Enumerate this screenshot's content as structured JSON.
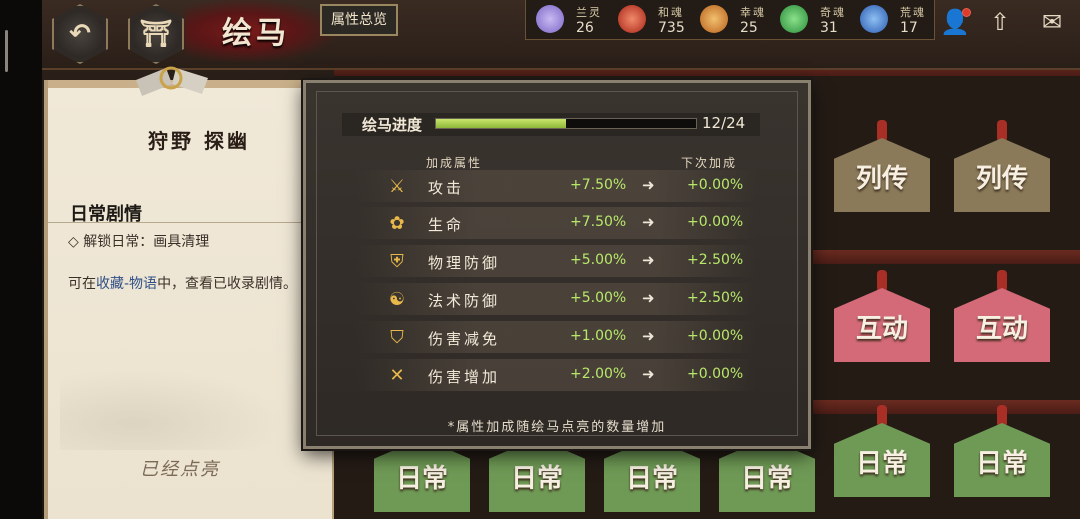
{
  "header": {
    "title": "绘马",
    "attr_button": "属性总览"
  },
  "currencies": [
    {
      "name": "兰灵",
      "value": "26",
      "color": "#8d7fd6",
      "icon": "spirit-icon"
    },
    {
      "name": "和魂",
      "value": "735",
      "color": "#c83a2a",
      "icon": "peace-soul-icon"
    },
    {
      "name": "幸魂",
      "value": "25",
      "color": "#d98a2a",
      "icon": "luck-soul-icon"
    },
    {
      "name": "奇魂",
      "value": "31",
      "color": "#3fa24a",
      "icon": "wonder-soul-icon"
    },
    {
      "name": "荒魂",
      "value": "17",
      "color": "#3c7fd0",
      "icon": "rough-soul-icon"
    }
  ],
  "left_panel": {
    "title": "狩野 探幽",
    "section_title": "日常剧情",
    "unlock": "◇ 解锁日常：画具清理",
    "desc_prefix": "可在",
    "desc_link": "收藏-物语",
    "desc_suffix": "中，查看已收录剧情。",
    "status": "已经点亮"
  },
  "ema_labels": [
    "列传",
    "列传",
    "互动",
    "互动",
    "日常",
    "日常",
    "日常",
    "日常",
    "日常",
    "日常"
  ],
  "modal": {
    "progress_label": "绘马进度",
    "progress_text": "12/24",
    "progress_value": 0.5,
    "col_attr": "加成属性",
    "col_next": "下次加成",
    "rows": [
      {
        "name": "攻击",
        "icon": "sword-icon",
        "current": "+7.50%",
        "next": "+0.00%"
      },
      {
        "name": "生命",
        "icon": "flower-icon",
        "current": "+7.50%",
        "next": "+0.00%"
      },
      {
        "name": "物理防御",
        "icon": "armor-icon",
        "current": "+5.00%",
        "next": "+2.50%"
      },
      {
        "name": "法术防御",
        "icon": "yin-yang-icon",
        "current": "+5.00%",
        "next": "+2.50%"
      },
      {
        "name": "伤害减免",
        "icon": "shield-icon",
        "current": "+1.00%",
        "next": "+0.00%"
      },
      {
        "name": "伤害增加",
        "icon": "crossed-swords-icon",
        "current": "+2.00%",
        "next": "+0.00%"
      }
    ],
    "note": "*属性加成随绘马点亮的数量增加"
  }
}
